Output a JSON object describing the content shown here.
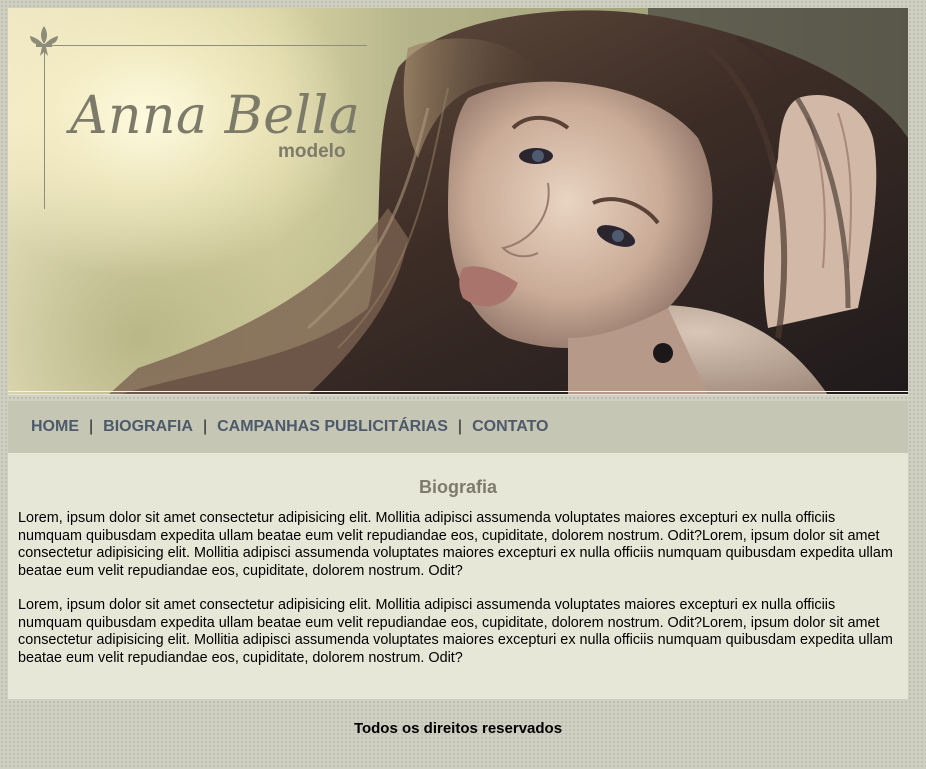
{
  "header": {
    "logo_title": "Anna Bella",
    "logo_subtitle": "modelo",
    "logo_icon": "fleur-de-lis-icon",
    "banner_image": "model-portrait-photo"
  },
  "nav": {
    "items": [
      {
        "label": "HOME"
      },
      {
        "label": "BIOGRAFIA"
      },
      {
        "label": "CAMPANHAS PUBLICITÁRIAS"
      },
      {
        "label": "CONTATO"
      }
    ],
    "separator": "|"
  },
  "main": {
    "title": "Biografia",
    "paragraphs": [
      "Lorem, ipsum dolor sit amet consectetur adipisicing elit. Mollitia adipisci assumenda voluptates maiores excepturi ex nulla officiis numquam quibusdam expedita ullam beatae eum velit repudiandae eos, cupiditate, dolorem nostrum. Odit?Lorem, ipsum dolor sit amet consectetur adipisicing elit. Mollitia adipisci assumenda voluptates maiores excepturi ex nulla officiis numquam quibusdam expedita ullam beatae eum velit repudiandae eos, cupiditate, dolorem nostrum. Odit?",
      "Lorem, ipsum dolor sit amet consectetur adipisicing elit. Mollitia adipisci assumenda voluptates maiores excepturi ex nulla officiis numquam quibusdam expedita ullam beatae eum velit repudiandae eos, cupiditate, dolorem nostrum. Odit?Lorem, ipsum dolor sit amet consectetur adipisicing elit. Mollitia adipisci assumenda voluptates maiores excepturi ex nulla officiis numquam quibusdam expedita ullam beatae eum velit repudiandae eos, cupiditate, dolorem nostrum. Odit?"
    ]
  },
  "footer": {
    "text": "Todos os direitos reservados"
  },
  "colors": {
    "page_background": "#cfd0c2",
    "nav_background": "#c6c6b4",
    "nav_link": "#4d5a6b",
    "content_background": "#e7e7d8",
    "title": "#7d7b6c",
    "logo": "#7c7a68"
  }
}
